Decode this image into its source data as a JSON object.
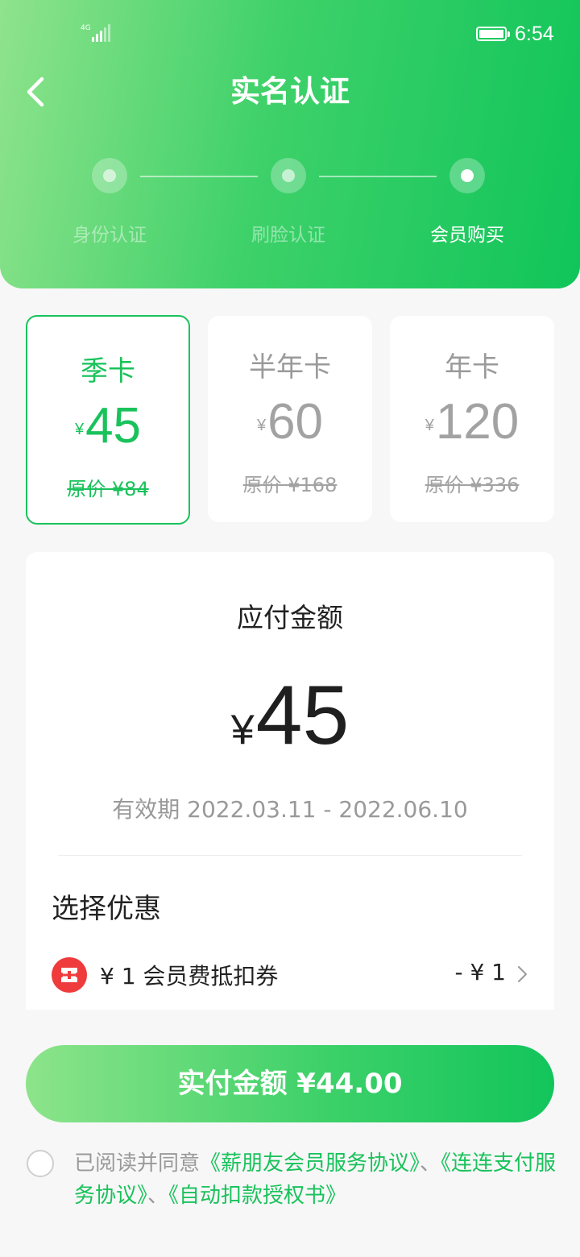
{
  "status_bar": {
    "network": "4G",
    "time": "6:54"
  },
  "header": {
    "title": "实名认证"
  },
  "steps": [
    {
      "label": "身份认证",
      "active": false
    },
    {
      "label": "刷脸认证",
      "active": false
    },
    {
      "label": "会员购买",
      "active": true
    }
  ],
  "plans": [
    {
      "name": "季卡",
      "currency": "¥",
      "price": "45",
      "original": "原价 ¥84",
      "selected": true
    },
    {
      "name": "半年卡",
      "currency": "¥",
      "price": "60",
      "original": "原价 ¥168",
      "selected": false
    },
    {
      "name": "年卡",
      "currency": "¥",
      "price": "120",
      "original": "原价 ¥336",
      "selected": false
    }
  ],
  "summary": {
    "due_label": "应付金额",
    "currency": "¥",
    "due_amount": "45",
    "validity": "有效期 2022.03.11 - 2022.06.10",
    "discount_title": "选择优惠",
    "coupon_label": "¥ 1 会员费抵扣券",
    "coupon_value": "- ¥ 1"
  },
  "pay_button": {
    "label": "实付金额 ¥44.00"
  },
  "agreement": {
    "prefix": "已阅读并同意",
    "link1": "《薪朋友会员服务协议》",
    "sep1": "、",
    "link2": "《连连支付服务协议》",
    "sep2": "、",
    "link3": "《自动扣款授权书》",
    "checked": false
  },
  "colors": {
    "accent": "#19c25a",
    "coupon": "#ef3b3b"
  }
}
